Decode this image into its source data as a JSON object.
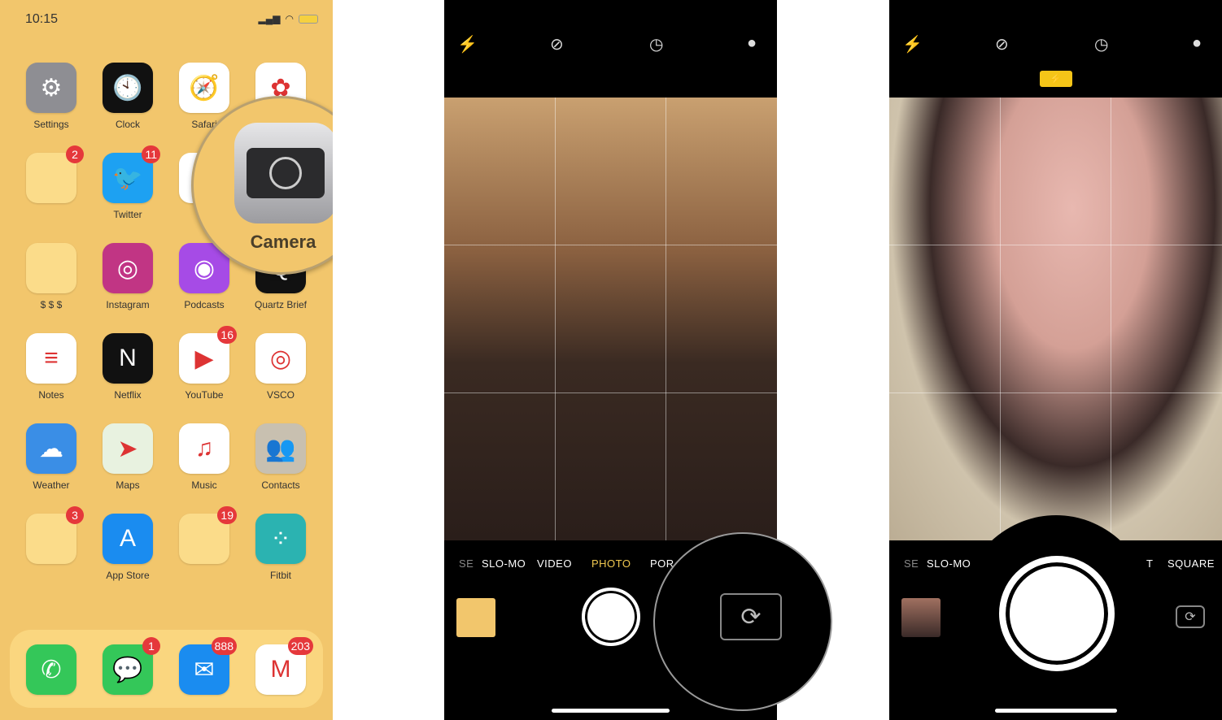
{
  "home": {
    "status": {
      "time": "10:15",
      "signal_icon": "signal-icon",
      "wifi_icon": "wifi-icon",
      "battery_icon": "battery-icon"
    },
    "apps": [
      {
        "label": "Settings",
        "color": "#8e8e93",
        "glyph": "⚙",
        "badge": ""
      },
      {
        "label": "Clock",
        "color": "#111111",
        "glyph": "🕙",
        "badge": ""
      },
      {
        "label": "Safari",
        "color": "#ffffff",
        "glyph": "🧭",
        "badge": ""
      },
      {
        "label": "",
        "color": "#ffffff",
        "glyph": "✿",
        "badge": ""
      },
      {
        "label": "",
        "color": "#fbdc8a",
        "glyph": "",
        "badge": "2"
      },
      {
        "label": "Twitter",
        "color": "#1da1f2",
        "glyph": "🐦",
        "badge": "11"
      },
      {
        "label": "Ca",
        "color": "#ffffff",
        "glyph": "",
        "badge": ""
      },
      {
        "label": "",
        "color": "#f2c66c",
        "glyph": "",
        "badge": ""
      },
      {
        "label": "$ $ $",
        "color": "#fbdc8a",
        "glyph": "",
        "badge": ""
      },
      {
        "label": "Instagram",
        "color": "#c13584",
        "glyph": "◎",
        "badge": ""
      },
      {
        "label": "Podcasts",
        "color": "#a64be6",
        "glyph": "◉",
        "badge": ""
      },
      {
        "label": "Quartz Brief",
        "color": "#111111",
        "glyph": "Q",
        "badge": ""
      },
      {
        "label": "Notes",
        "color": "#ffffff",
        "glyph": "≡",
        "badge": ""
      },
      {
        "label": "Netflix",
        "color": "#111111",
        "glyph": "N",
        "badge": ""
      },
      {
        "label": "YouTube",
        "color": "#ffffff",
        "glyph": "▶",
        "badge": "16"
      },
      {
        "label": "VSCO",
        "color": "#ffffff",
        "glyph": "◎",
        "badge": ""
      },
      {
        "label": "Weather",
        "color": "#3a8ee6",
        "glyph": "☁",
        "badge": ""
      },
      {
        "label": "Maps",
        "color": "#e8f2e0",
        "glyph": "➤",
        "badge": ""
      },
      {
        "label": "Music",
        "color": "#ffffff",
        "glyph": "♫",
        "badge": ""
      },
      {
        "label": "Contacts",
        "color": "#c8c0b0",
        "glyph": "👥",
        "badge": ""
      },
      {
        "label": "",
        "color": "#fbdc8a",
        "glyph": "",
        "badge": "3"
      },
      {
        "label": "App Store",
        "color": "#1a8cf0",
        "glyph": "A",
        "badge": ""
      },
      {
        "label": "",
        "color": "#fbdc8a",
        "glyph": "",
        "badge": "19"
      },
      {
        "label": "Fitbit",
        "color": "#2bb3b1",
        "glyph": "⁘",
        "badge": ""
      }
    ],
    "dock": [
      {
        "label": "Phone",
        "color": "#34c759",
        "glyph": "✆",
        "badge": ""
      },
      {
        "label": "Messages",
        "color": "#34c759",
        "glyph": "💬",
        "badge": "1"
      },
      {
        "label": "Mail",
        "color": "#1a8cf0",
        "glyph": "✉",
        "badge": "888"
      },
      {
        "label": "Gmail",
        "color": "#ffffff",
        "glyph": "M",
        "badge": "203"
      }
    ],
    "magnified_app": {
      "label": "Camera"
    }
  },
  "camera_back": {
    "top_icons": [
      "flash-icon",
      "live-photo-off-icon",
      "timer-icon",
      "filters-icon"
    ],
    "modes": [
      "SE",
      "SLO-MO",
      "VIDEO",
      "PHOTO",
      "POR"
    ],
    "active_mode": "PHOTO",
    "accent": "#f5c518"
  },
  "camera_front": {
    "top_icons": [
      "flash-icon",
      "live-photo-off-icon",
      "timer-icon",
      "filters-icon"
    ],
    "flash_badge_icon": "flash-on-icon",
    "modes": [
      "SE",
      "SLO-MO",
      "T",
      "SQUARE"
    ]
  }
}
